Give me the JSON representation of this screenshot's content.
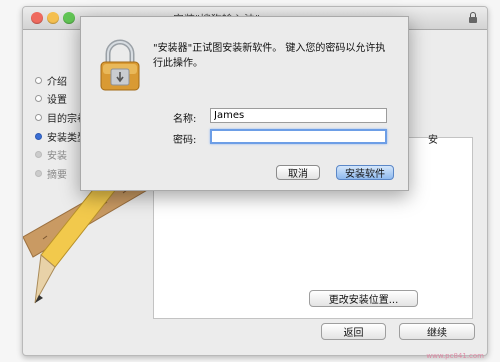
{
  "window": {
    "title": "安装\"搜狗输入法\"",
    "controls": [
      "close",
      "minimize",
      "zoom"
    ]
  },
  "sidebar": {
    "steps": [
      {
        "label": "介绍",
        "state": "done"
      },
      {
        "label": "设置",
        "state": "done"
      },
      {
        "label": "目的宗卷",
        "state": "done"
      },
      {
        "label": "安装类型",
        "state": "active"
      },
      {
        "label": "安装",
        "state": "pending"
      },
      {
        "label": "摘要",
        "state": "pending"
      }
    ]
  },
  "content": {
    "truncated_text": "安",
    "change_location_button": "更改安装位置...",
    "back_button": "返回",
    "continue_button": "继续"
  },
  "auth_dialog": {
    "message": "\"安装器\"正试图安装新软件。 键入您的密码以允许执行此操作。",
    "name_label": "名称:",
    "name_value": "James",
    "password_label": "密码:",
    "password_value": "",
    "cancel_button": "取消",
    "install_button": "安装软件",
    "icon": "padlock-icon"
  },
  "watermark": {
    "text": "www.pc841.com"
  },
  "colors": {
    "active_step": "#3b6fd4",
    "default_button": "#8fb9ee",
    "focus_ring": "#6d9ee6"
  }
}
